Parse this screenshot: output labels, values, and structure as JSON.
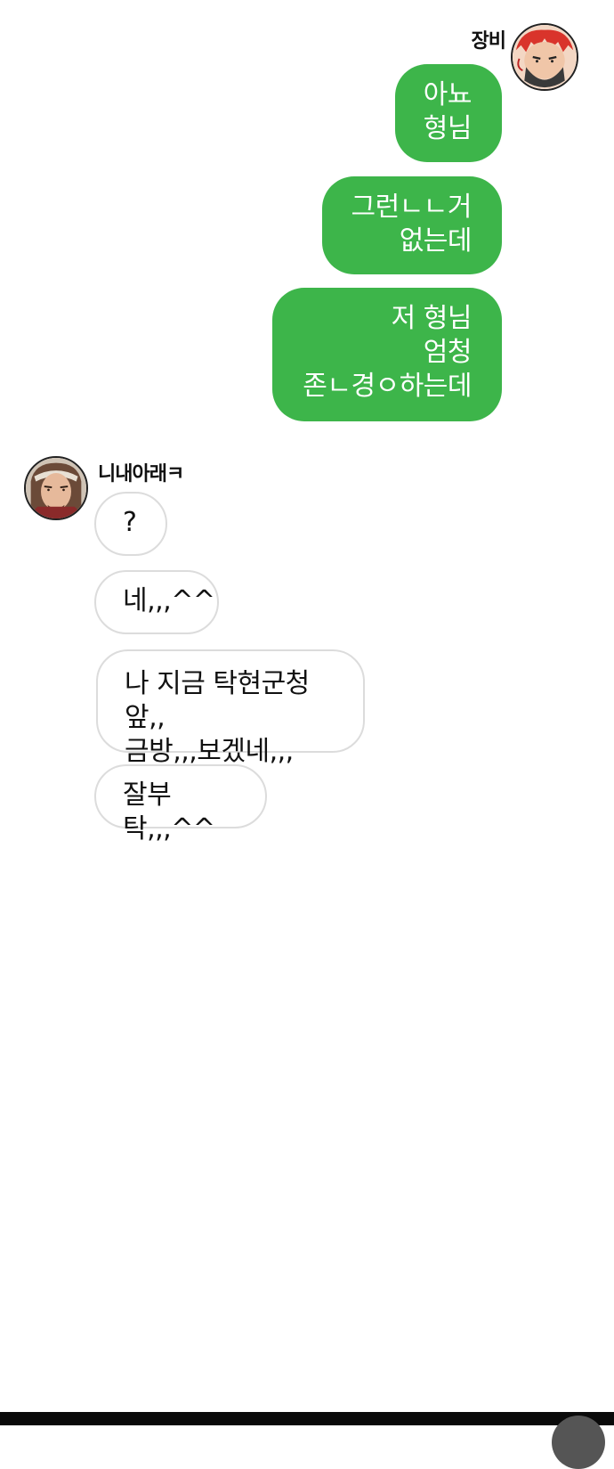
{
  "outgoing": {
    "sender_name": "장비",
    "messages": [
      "아뇨\n형님",
      "그런ㄴㄴ거\n없는데",
      "저 형님\n엄청\n존ㄴ경ㅇ하는데"
    ],
    "bubble_color": "#3db54a"
  },
  "incoming": {
    "sender_name": "니내아래ㅋ",
    "messages": [
      "?",
      "네,,,^^",
      "나 지금 탁현군청앞,,\n금방,,,보겠네,,,",
      "잘부탁,,,^^"
    ],
    "bubble_border_color": "#dcdcdc"
  }
}
